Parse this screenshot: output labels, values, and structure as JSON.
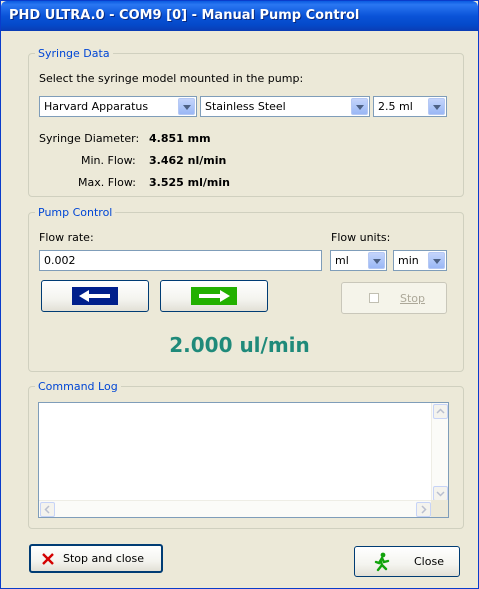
{
  "window": {
    "title": "PHD ULTRA.0 - COM9 [0] - Manual Pump Control"
  },
  "syringe_data": {
    "legend": "Syringe Data",
    "instruction": "Select the syringe model mounted in the pump:",
    "manufacturer": "Harvard Apparatus",
    "model": "Stainless Steel",
    "volume": "2.5 ml",
    "diameter_label": "Syringe Diameter:",
    "diameter_value": "4.851 mm",
    "min_flow_label": "Min. Flow:",
    "min_flow_value": "3.462 nl/min",
    "max_flow_label": "Max. Flow:",
    "max_flow_value": "3.525 ml/min"
  },
  "pump_control": {
    "legend": "Pump Control",
    "flow_rate_label": "Flow rate:",
    "flow_rate_value": "0.002",
    "flow_units_label": "Flow units:",
    "volume_unit": "ml",
    "time_unit": "min",
    "withdraw_icon": "left-arrow-icon",
    "infuse_icon": "right-arrow-icon",
    "stop_label": "Stop",
    "current_flow": "2.000 ul/min"
  },
  "command_log": {
    "legend": "Command Log",
    "entries": []
  },
  "footer": {
    "stop_and_close_label": "Stop and close",
    "close_label": "Close"
  },
  "colors": {
    "title_bar": "#0a53d8",
    "group_legend": "#0046d5",
    "flow_display": "#1f8a7a",
    "withdraw_button_fill": "#001f8c",
    "infuse_button_fill": "#22b000"
  }
}
